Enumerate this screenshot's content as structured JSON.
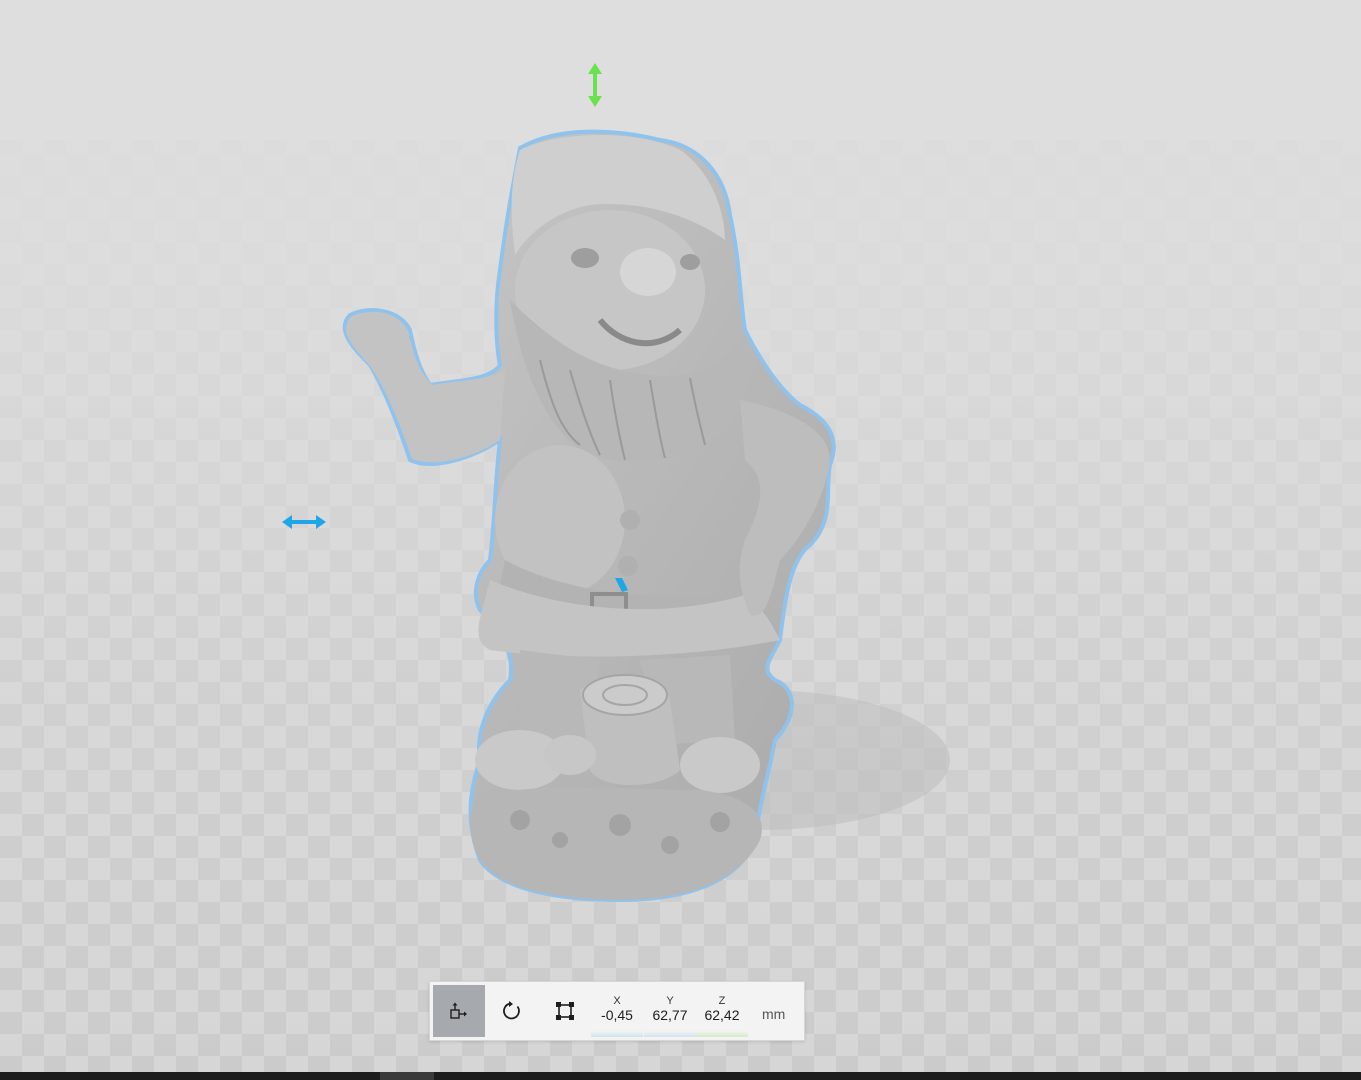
{
  "toolbar": {
    "tools": [
      {
        "name": "move",
        "icon": "move-icon",
        "active": true
      },
      {
        "name": "rotate",
        "icon": "rotate-icon",
        "active": false
      },
      {
        "name": "scale",
        "icon": "scale-icon",
        "active": false
      }
    ],
    "coordinates": {
      "x": {
        "label": "X",
        "value": "-0,45"
      },
      "y": {
        "label": "Y",
        "value": "62,77"
      },
      "z": {
        "label": "Z",
        "value": "62,42"
      }
    },
    "unit": "mm"
  },
  "viewport": {
    "model": "gnome-figurine",
    "gizmo_colors": {
      "vertical_axis": "#6ae24f",
      "horizontal_axis": "#1ea7e8",
      "selection_outline": "#8fc3ee"
    }
  }
}
